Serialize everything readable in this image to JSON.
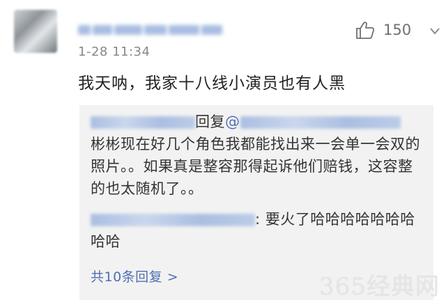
{
  "comment": {
    "timestamp": "1-28 11:34",
    "like_count": "150",
    "text": "我天呐，我家十八线小演员也有人黑"
  },
  "replies": [
    {
      "prefix": "回复",
      "mention": "@",
      "text": "彬彬现在好几个角色我都能找出来一会单一会双的照片。。如果真是整容那得起诉他们赔钱，这容整的也太随机了。。"
    },
    {
      "prefix": ":",
      "text": " 要火了哈哈哈哈哈哈哈哈哈"
    }
  ],
  "more_replies_label": "共10条回复 >",
  "watermark": "365经典网",
  "icons": {
    "like": "thumbs-up-icon",
    "more": "chevron-down-icon"
  },
  "colors": {
    "link": "#4f6fb2",
    "reply_bg": "#f2f2f2",
    "meta": "#888888"
  }
}
